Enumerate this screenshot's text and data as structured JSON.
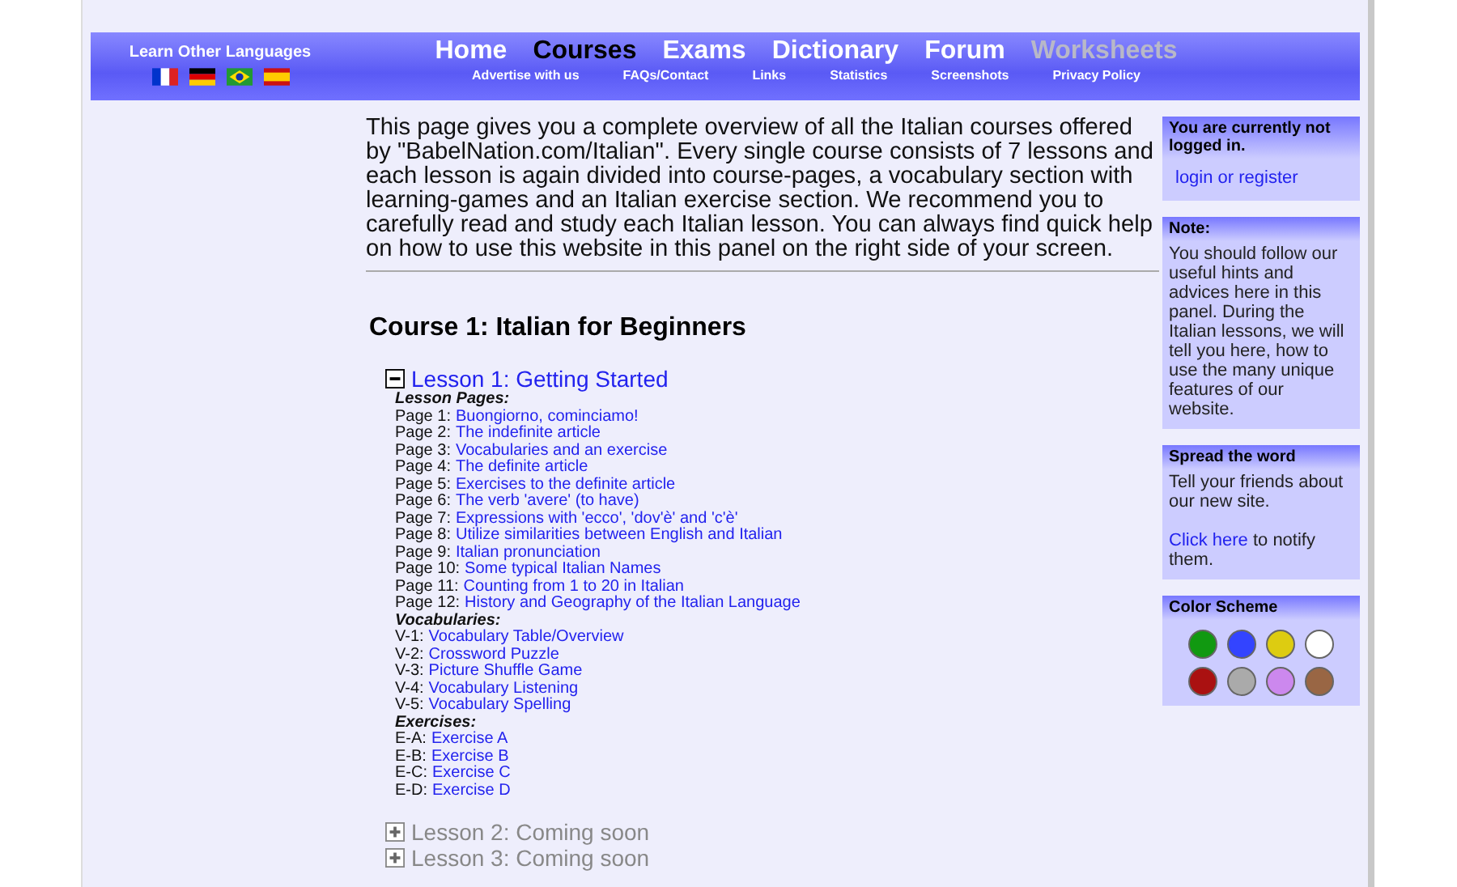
{
  "languages": {
    "title": "Learn Other Languages",
    "flags": [
      {
        "kind": "france"
      },
      {
        "kind": "germany"
      },
      {
        "kind": "brazil"
      },
      {
        "kind": "spain"
      }
    ]
  },
  "main_nav": [
    {
      "label": "Home",
      "selected": false,
      "disabled": false
    },
    {
      "label": "Courses",
      "selected": true,
      "disabled": false
    },
    {
      "label": "Exams",
      "selected": false,
      "disabled": false
    },
    {
      "label": "Dictionary",
      "selected": false,
      "disabled": false
    },
    {
      "label": "Forum",
      "selected": false,
      "disabled": false
    },
    {
      "label": "Worksheets",
      "selected": false,
      "disabled": true
    }
  ],
  "sub_nav": [
    "Advertise with us",
    "FAQs/Contact",
    "Links",
    "Statistics",
    "Screenshots",
    "Privacy Policy"
  ],
  "intro": "This page gives you a complete overview of all the Italian courses offered by \"BabelNation.com/Italian\". Every single course consists of 7 lessons and each lesson is again divided into course-pages, a vocabulary section with learning-games and an Italian exercise section. We recommend you to carefully read and study each Italian lesson. You can always find quick help on how to use this website in this panel on the right side of your screen.",
  "course_title": "Course 1: Italian for Beginners",
  "lessons": [
    {
      "title": "Lesson 1: Getting Started",
      "expanded": true,
      "disabled": false,
      "sections": [
        {
          "title": "Lesson Pages:",
          "items": [
            {
              "prefix": "Page 1:",
              "link": "Buongiorno, cominciamo!"
            },
            {
              "prefix": "Page 2:",
              "link": "The indefinite article"
            },
            {
              "prefix": "Page 3:",
              "link": "Vocabularies and an exercise"
            },
            {
              "prefix": "Page 4:",
              "link": "The definite article"
            },
            {
              "prefix": "Page 5:",
              "link": "Exercises to the definite article"
            },
            {
              "prefix": "Page 6:",
              "link": "The verb 'avere' (to have)"
            },
            {
              "prefix": "Page 7:",
              "link": "Expressions with 'ecco', 'dov'è' and 'c'è'"
            },
            {
              "prefix": "Page 8:",
              "link": "Utilize similarities between English and Italian"
            },
            {
              "prefix": "Page 9:",
              "link": "Italian pronunciation"
            },
            {
              "prefix": "Page 10:",
              "link": "Some typical Italian Names"
            },
            {
              "prefix": "Page 11:",
              "link": "Counting from 1 to 20 in Italian"
            },
            {
              "prefix": "Page 12:",
              "link": "History and Geography of the Italian Language"
            }
          ]
        },
        {
          "title": "Vocabularies:",
          "items": [
            {
              "prefix": "V-1:",
              "link": "Vocabulary Table/Overview"
            },
            {
              "prefix": "V-2:",
              "link": "Crossword Puzzle"
            },
            {
              "prefix": "V-3:",
              "link": "Picture Shuffle Game"
            },
            {
              "prefix": "V-4:",
              "link": "Vocabulary Listening"
            },
            {
              "prefix": "V-5:",
              "link": "Vocabulary Spelling"
            }
          ]
        },
        {
          "title": "Exercises:",
          "items": [
            {
              "prefix": "E-A:",
              "link": "Exercise A"
            },
            {
              "prefix": "E-B:",
              "link": "Exercise B"
            },
            {
              "prefix": "E-C:",
              "link": "Exercise C"
            },
            {
              "prefix": "E-D:",
              "link": "Exercise D"
            }
          ]
        }
      ]
    },
    {
      "title": "Lesson 2: Coming soon",
      "expanded": false,
      "disabled": true
    },
    {
      "title": "Lesson 3: Coming soon",
      "expanded": false,
      "disabled": true
    }
  ],
  "sidebar": {
    "login": {
      "title": "You are currently not logged in.",
      "link": "login or register"
    },
    "note": {
      "title": "Note:",
      "text": "You should follow our useful hints and advices here in this panel. During the Italian lessons, we will tell you here, how to use the many unique features of our website."
    },
    "spread": {
      "title": "Spread the word",
      "text": "Tell your friends about our new site.",
      "link": "Click here",
      "after": "to notify them."
    },
    "colors": {
      "title": "Color Scheme",
      "swatches": [
        {
          "color": "#119911"
        },
        {
          "color": "#3344ff"
        },
        {
          "color": "#ddcc11"
        },
        {
          "color": "#ffffff"
        },
        {
          "color": "#aa1111"
        },
        {
          "color": "#aaaaaa"
        },
        {
          "color": "#cc88ee"
        },
        {
          "color": "#996644"
        }
      ]
    }
  }
}
